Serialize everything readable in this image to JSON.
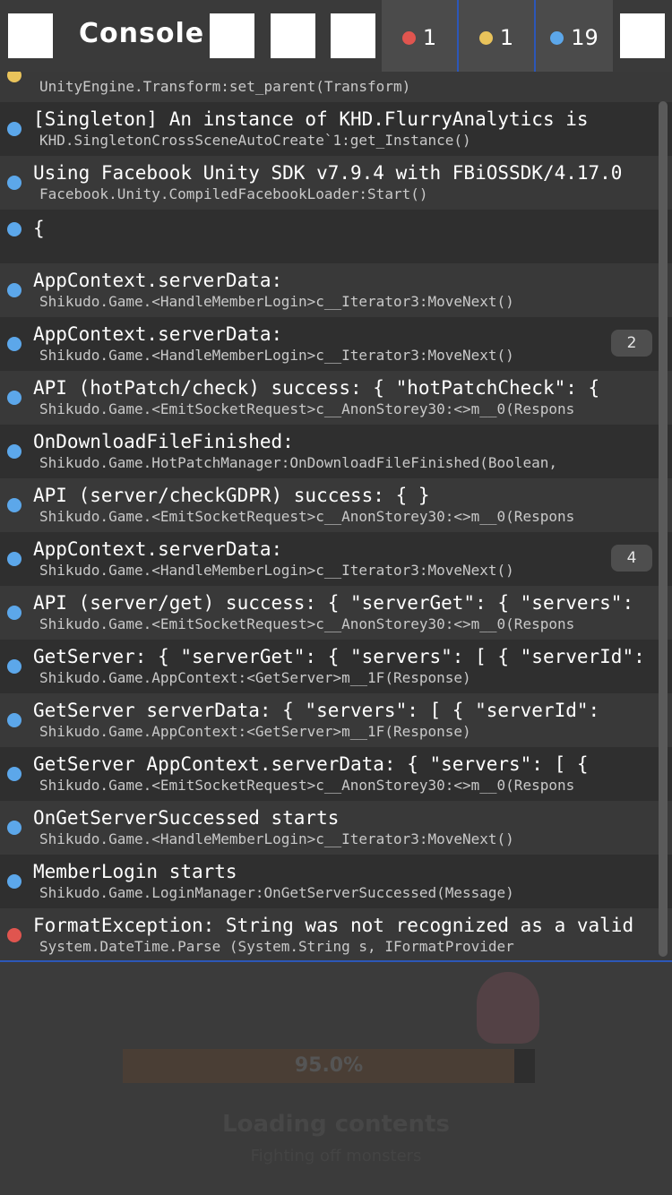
{
  "colors": {
    "error": "#e0554f",
    "warning": "#e9c35b",
    "info": "#5ca7ea",
    "accent": "#2c57b8"
  },
  "toolbar": {
    "title": "Console",
    "counters": [
      {
        "type": "error",
        "count": "1"
      },
      {
        "type": "warning",
        "count": "1"
      },
      {
        "type": "info",
        "count": "19"
      }
    ]
  },
  "log": {
    "entries": [
      {
        "level": "warning",
        "message": "",
        "trace": "UnityEngine.Transform:set_parent(Transform)",
        "collapse_count": ""
      },
      {
        "level": "info",
        "message": "[Singleton] An instance of KHD.FlurryAnalytics is",
        "trace": "KHD.SingletonCrossSceneAutoCreate`1:get_Instance()",
        "collapse_count": ""
      },
      {
        "level": "info",
        "message": "Using Facebook Unity SDK v7.9.4 with FBiOSSDK/4.17.0",
        "trace": "Facebook.Unity.CompiledFacebookLoader:Start()",
        "collapse_count": ""
      },
      {
        "level": "info",
        "message": "{",
        "trace": "",
        "collapse_count": ""
      },
      {
        "level": "info",
        "message": "AppContext.serverData:",
        "trace": "Shikudo.Game.<HandleMemberLogin>c__Iterator3:MoveNext()",
        "collapse_count": ""
      },
      {
        "level": "info",
        "message": "AppContext.serverData:",
        "trace": "Shikudo.Game.<HandleMemberLogin>c__Iterator3:MoveNext()",
        "collapse_count": "2"
      },
      {
        "level": "info",
        "message": "API (hotPatch/check) success: { \"hotPatchCheck\": {",
        "trace": "Shikudo.Game.<EmitSocketRequest>c__AnonStorey30:<>m__0(Respons",
        "collapse_count": ""
      },
      {
        "level": "info",
        "message": "OnDownloadFileFinished:",
        "trace": "Shikudo.Game.HotPatchManager:OnDownloadFileFinished(Boolean,",
        "collapse_count": ""
      },
      {
        "level": "info",
        "message": "API (server/checkGDPR) success: { }",
        "trace": "Shikudo.Game.<EmitSocketRequest>c__AnonStorey30:<>m__0(Respons",
        "collapse_count": ""
      },
      {
        "level": "info",
        "message": "AppContext.serverData:",
        "trace": "Shikudo.Game.<HandleMemberLogin>c__Iterator3:MoveNext()",
        "collapse_count": "4"
      },
      {
        "level": "info",
        "message": "API (server/get) success: { \"serverGet\": { \"servers\":",
        "trace": "Shikudo.Game.<EmitSocketRequest>c__AnonStorey30:<>m__0(Respons",
        "collapse_count": ""
      },
      {
        "level": "info",
        "message": "GetServer: { \"serverGet\": { \"servers\": [ { \"serverId\":",
        "trace": "Shikudo.Game.AppContext:<GetServer>m__1F(Response)",
        "collapse_count": ""
      },
      {
        "level": "info",
        "message": "GetServer serverData: { \"servers\": [ { \"serverId\":",
        "trace": "Shikudo.Game.AppContext:<GetServer>m__1F(Response)",
        "collapse_count": ""
      },
      {
        "level": "info",
        "message": "GetServer AppContext.serverData: { \"servers\": [ {",
        "trace": "Shikudo.Game.<EmitSocketRequest>c__AnonStorey30:<>m__0(Respons",
        "collapse_count": ""
      },
      {
        "level": "info",
        "message": "OnGetServerSuccessed starts",
        "trace": "Shikudo.Game.<HandleMemberLogin>c__Iterator3:MoveNext()",
        "collapse_count": ""
      },
      {
        "level": "info",
        "message": "MemberLogin starts",
        "trace": "Shikudo.Game.LoginManager:OnGetServerSuccessed(Message)",
        "collapse_count": ""
      },
      {
        "level": "error",
        "message": "FormatException: String was not recognized as a valid",
        "trace": "System.DateTime.Parse (System.String s, IFormatProvider",
        "collapse_count": ""
      }
    ]
  },
  "loading": {
    "progress_text": "95.0%",
    "progress": 0.95,
    "title": "Loading contents",
    "subtitle": "Fighting off monsters"
  }
}
